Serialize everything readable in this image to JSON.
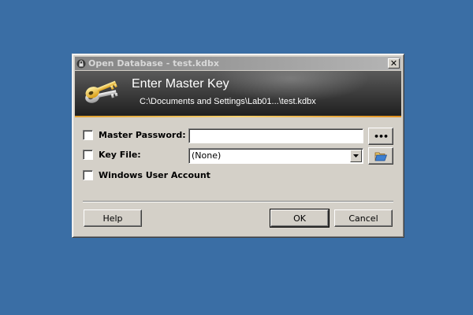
{
  "window": {
    "title": "Open Database - test.kdbx",
    "close_label": "✕"
  },
  "banner": {
    "title": "Enter Master Key",
    "subtitle": "C:\\Documents and Settings\\Lab01...\\test.kdbx"
  },
  "master_password": {
    "label": "Master Password:",
    "value": "",
    "checked": false,
    "reveal_button_label": "•••"
  },
  "key_file": {
    "label": "Key File:",
    "selected": "(None)",
    "checked": false
  },
  "windows_account": {
    "label": "Windows User Account",
    "checked": false
  },
  "buttons": {
    "help": "Help",
    "ok": "OK",
    "cancel": "Cancel"
  },
  "colors": {
    "desktop": "#3a6ea5",
    "dialog": "#d4d0c8",
    "banner_accent": "#f0b040"
  },
  "icons": {
    "title": "lock-icon",
    "banner": "key-icon",
    "browse": "folder-open-icon",
    "dropdown": "chevron-down-icon"
  }
}
